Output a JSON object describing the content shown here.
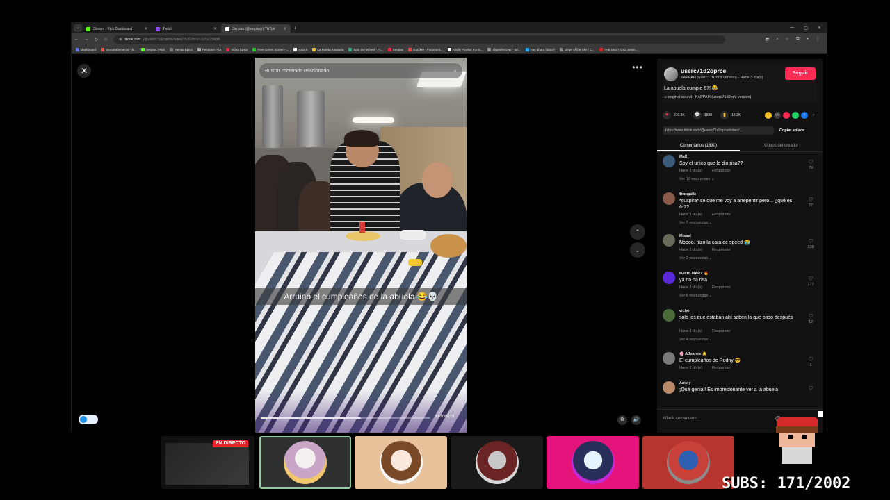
{
  "browser": {
    "tabs": [
      {
        "title": "Stream - Kick Dashboard",
        "color": "#53fc18",
        "active": false
      },
      {
        "title": "Twitch",
        "color": "#9146ff",
        "active": false
      },
      {
        "title": "Serpias (@serpias) | TikTok",
        "color": "#ffffff",
        "active": true
      }
    ],
    "url_host": "tiktok.com",
    "url_path": "/@userc71d2oprce/video/7570282207379729688",
    "bookmarks": [
      "Dashboard",
      "StreamElements - S...",
      "Serpias | Kick",
      "Hentai Epico",
      "Femboys +18",
      "Video Epico",
      "Free Green Screen -...",
      "Para ti",
      "La Ruleta Aleatoria",
      "Spin the Wheel - Fr...",
      "Serpias",
      "GrafiMe - Fotomont...",
      "A Silly Playlist For S...",
      "@jamferrover - 08...",
      "Hay ahora fútbol?",
      "Dirge of the Sky | C...",
      "THE BEST CS2 Settin..."
    ]
  },
  "video": {
    "search_placeholder": "Buscar contenido relacionado",
    "caption": "Arruinó el cumpleaños de la abuela 😂💀",
    "time": "00:30/00:51",
    "progress": 0.59
  },
  "author": {
    "username": "userc71d2oprce",
    "subtitle": "KAPPAH (userc71d2or's version) · Hace 3 día(s)",
    "follow_label": "Seguir",
    "description": "La abuela cumple 67! 😂",
    "sound": "♫ original sound - KAPPAH (userc71d2or's version)"
  },
  "stats": {
    "likes": "210.3K",
    "comments": "1830",
    "saves": "18.2K"
  },
  "link": {
    "url": "https://www.tiktok.com/@userc71d2oprce/video/...",
    "copy_label": "Copiar enlace"
  },
  "tabs": {
    "comments": "Comentarios (1830)",
    "creator_videos": "Videos del creador"
  },
  "comments": [
    {
      "user": "MaX",
      "text": "Soy el unico que le dio risa??",
      "time": "Hace 3 día(s)",
      "reply": "Responder",
      "replies": "Ver 16 respuestas ⌄",
      "likes": "73",
      "avatar": "#3a5a7a"
    },
    {
      "user": "𝕲𝖗𝖊𝖈𝖔𝖕𝖔𝖑𝖎𝖘",
      "text": "*suspira* sé que me voy a arrepentir pero... ¿qué es 6-7?",
      "time": "Hace 3 día(s)",
      "reply": "Responder",
      "replies": "Ver 7 respuestas ⌄",
      "likes": "27",
      "avatar": "#8a5a4a"
    },
    {
      "user": "Misael",
      "text": "Noooo, hizo la cara de speed 😭",
      "time": "Hace 3 día(s)",
      "reply": "Responder",
      "replies": "Ver 2 respuestas ⌄",
      "likes": "339",
      "avatar": "#6a6a5a"
    },
    {
      "user": "ᴍᴀʀɪᴏ.MARZ 🔥",
      "text": "ya no da risa",
      "time": "Hace 3 día(s)",
      "reply": "Responder",
      "replies": "Ver 8 respuestas ⌄",
      "likes": "177",
      "avatar": "#5a2ad8"
    },
    {
      "user": "vicho",
      "text": "solo los que estaban ahí saben lo que paso después",
      "time": "Hace 3 día(s)",
      "reply": "Responder",
      "replies": "Ver 4 respuestas ⌄",
      "likes": "12",
      "avatar": "#4a6a3a"
    },
    {
      "user": "🌸 AJuanes 🌟",
      "text": "El cumpleaños de Rodny 😎",
      "time": "Hace 2 día(s)",
      "reply": "Responder",
      "replies": "",
      "likes": "1",
      "avatar": "#7a7a7a"
    },
    {
      "user": "Amely",
      "text": "¡Qué genial! Es impresionante ver a la abuela",
      "time": "",
      "reply": "",
      "replies": "",
      "likes": "",
      "avatar": "#b88a6a"
    }
  ],
  "add_comment_placeholder": "Añadir comentario...",
  "overlay": {
    "live_label": "EN DIRECTO",
    "subs_text": "SUBS: 171/2002"
  }
}
